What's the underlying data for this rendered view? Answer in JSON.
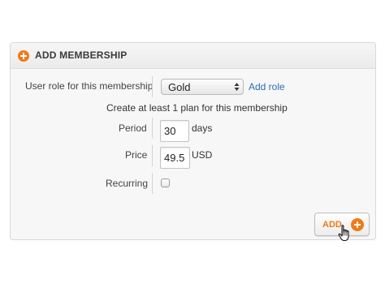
{
  "panel": {
    "title": "ADD MEMBERSHIP",
    "header_icon": "plus-circle-icon",
    "accent_color": "#f07a18"
  },
  "form": {
    "role_label": "User role for this membership",
    "role_value": "Gold",
    "add_role_link": "Add role",
    "plan_instruction": "Create at least 1 plan for this membership",
    "period_label": "Period",
    "period_value": "30",
    "period_unit": "days",
    "price_label": "Price",
    "price_value": "49.5",
    "price_unit": "USD",
    "recurring_label": "Recurring",
    "recurring_checked": false
  },
  "actions": {
    "add_label": "ADD",
    "add_icon": "plus-circle-icon",
    "link_color": "#2b6fb6"
  }
}
